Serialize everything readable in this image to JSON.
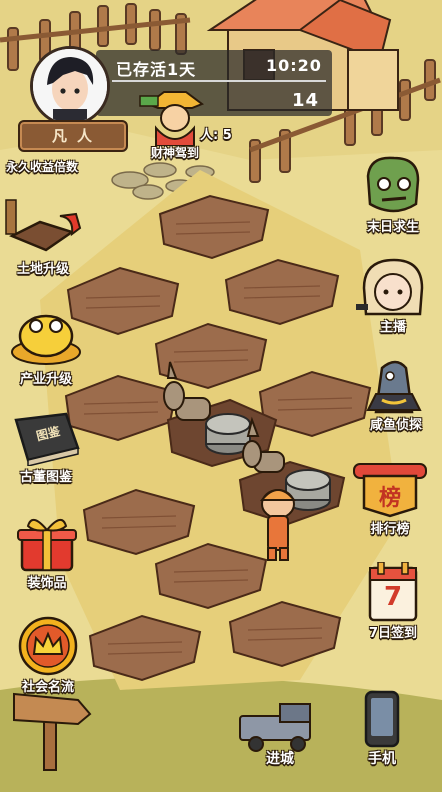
{
  "hud": {
    "survival_label": "已存活1天",
    "clock": "10:20",
    "counter": "14",
    "rank": "凡人",
    "multiplier_label": "永久收益倍数",
    "people_label": "人: 5"
  },
  "buttons": {
    "fortune_god": "财神驾到",
    "doomsday": "末日求生",
    "streamer": "主播",
    "salted_fish": "咸鱼侦探",
    "ranking": "排行榜",
    "ranking_icon": "榜",
    "checkin": "7日签到",
    "checkin_icon": "7",
    "land_upgrade": "土地升级",
    "industry_upgrade": "产业升级",
    "antique_book": "古董图鉴",
    "antique_icon": "图鉴",
    "decorations": "装饰品",
    "celebrities": "社会名流",
    "go_to_city": "进城",
    "phone": "手机"
  },
  "colors": {
    "grass": "#e9d98a",
    "soil": "#9a6a4a",
    "soil_dark": "#6e4630",
    "path": "#c9a86a",
    "outline": "#2a1a0a"
  }
}
